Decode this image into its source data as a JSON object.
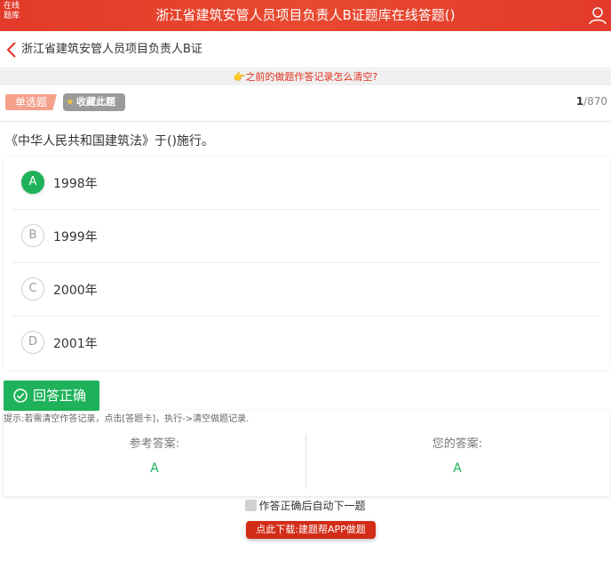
{
  "header": {
    "logo_text": "在线题库",
    "title": "浙江省建筑安管人员项目负责人B证题库在线答题()",
    "user_icon": "user-icon"
  },
  "nav": {
    "back_icon": "chevron-left-icon",
    "title": "浙江省建筑安管人员项目负责人B证"
  },
  "notice": {
    "icon": "👉",
    "text": "之前的做题作答记录怎么清空?"
  },
  "question_meta": {
    "type": "单选题",
    "favorite_label": "收藏此题",
    "current": "1",
    "total": "/870"
  },
  "question": {
    "text": "《中华人民共和国建筑法》于()施行。"
  },
  "options": [
    {
      "letter": "A",
      "text": "1998年",
      "selected": true
    },
    {
      "letter": "B",
      "text": "1999年",
      "selected": false
    },
    {
      "letter": "C",
      "text": "2000年",
      "selected": false
    },
    {
      "letter": "D",
      "text": "2001年",
      "selected": false
    }
  ],
  "result": {
    "label": "回答正确",
    "hint": "提示:若需清空作答记录，点击[答题卡]，执行->清空做题记录."
  },
  "answers": {
    "reference_label": "参考答案:",
    "reference_value": "A",
    "yours_label": "您的答案:",
    "yours_value": "A"
  },
  "footer": {
    "auto_next_label": "作答正确后自动下一题",
    "auto_next_checked": false,
    "download_label": "点此下载:建题帮APP做题"
  },
  "colors": {
    "header_red": "#e8492f",
    "correct_green": "#1fb25a",
    "notice_red": "#e0301e",
    "download_red": "#d32c17"
  }
}
